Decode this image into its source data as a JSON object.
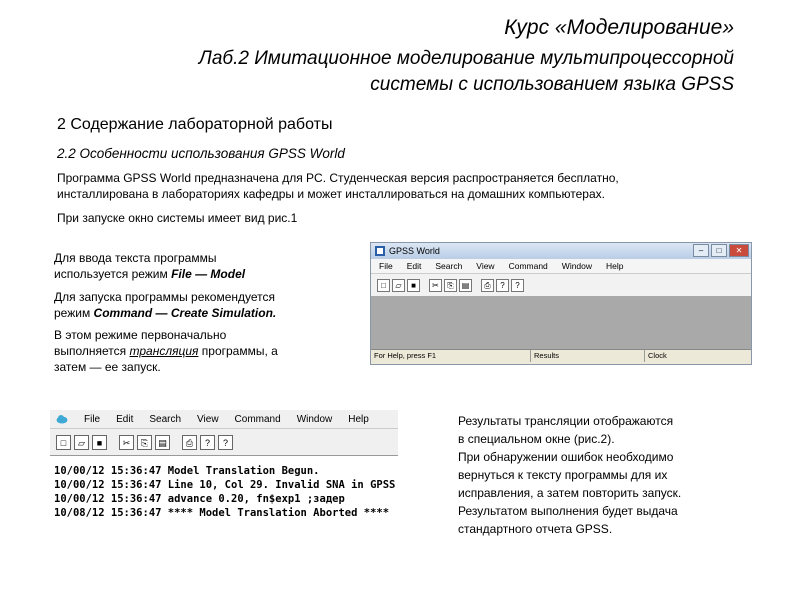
{
  "header": {
    "course_title": "Курс «Моделирование»",
    "lab_title_line1": "Лаб.2 Имитационное моделирование мультипроцессорной",
    "lab_title_line2": "системы с использованием языка GPSS"
  },
  "section": {
    "title": "2 Содержание лабораторной работы",
    "subtitle": "2.2 Особенности использования GPSS World"
  },
  "intro": {
    "line1": "Программа GPSS World предназначена для PC. Студенческая версия распространяется бесплатно,",
    "line2": "инсталлирована в лабораториях кафедры и может инсталлироваться на домашних компьютерах.",
    "line3": "При запуске окно системы имеет вид рис.1"
  },
  "left_text": {
    "p1_line1": "Для ввода текста программы",
    "p1_line2_pre": "используется режим ",
    "p1_line2_em": "File — Model",
    "p2_line1": "Для запуска программы рекомендуется",
    "p2_line2_pre": "режим ",
    "p2_line2_em": "Command — Create Simulation.",
    "p3_line1": "В этом режиме первоначально",
    "p3_line2_pre": "выполняется ",
    "p3_line2_u": "трансляция",
    "p3_line2_post": " программы, а",
    "p3_line3": "затем — ее запуск."
  },
  "window1": {
    "title": "GPSS World",
    "menu": [
      "File",
      "Edit",
      "Search",
      "View",
      "Command",
      "Window",
      "Help"
    ],
    "toolbar_icons": [
      "new-icon",
      "open-icon",
      "save-icon",
      "cut-icon",
      "copy-icon",
      "paste-icon",
      "print-icon",
      "help-icon",
      "context-help-icon"
    ],
    "toolbar_glyphs": [
      "□",
      "▱",
      "■",
      "✂",
      "⎘",
      "▤",
      "⎙",
      "?",
      "?"
    ],
    "controls": [
      "–",
      "□",
      "✕"
    ],
    "status": [
      "For Help, press F1",
      "Results",
      "Clock"
    ]
  },
  "window2": {
    "menu": [
      "File",
      "Edit",
      "Search",
      "View",
      "Command",
      "Window",
      "Help"
    ],
    "toolbar_glyphs": [
      "□",
      "▱",
      "■",
      "✂",
      "⎘",
      "▤",
      "⎙",
      "?",
      "?"
    ],
    "journal": [
      "10/00/12 15:36:47  Model Translation Begun.",
      "10/00/12 15:36:47  Line 10, Col 29. Invalid SNA in GPSS",
      "10/00/12 15:36:47  advance 0.20, fn$exp1        ;задер",
      "10/08/12 15:36:47  **** Model Translation Aborted ****"
    ]
  },
  "right_text": {
    "line1": "Результаты трансляции отображаются",
    "line2": "в специальном окне (рис.2).",
    "line3": "При обнаружении  ошибок необходимо",
    "line4": "вернуться к тексту программы для их",
    "line5": "исправления, а затем повторить запуск.",
    "line6": "Результатом выполнения будет выдача",
    "line7": "стандартного отчета GPSS."
  }
}
